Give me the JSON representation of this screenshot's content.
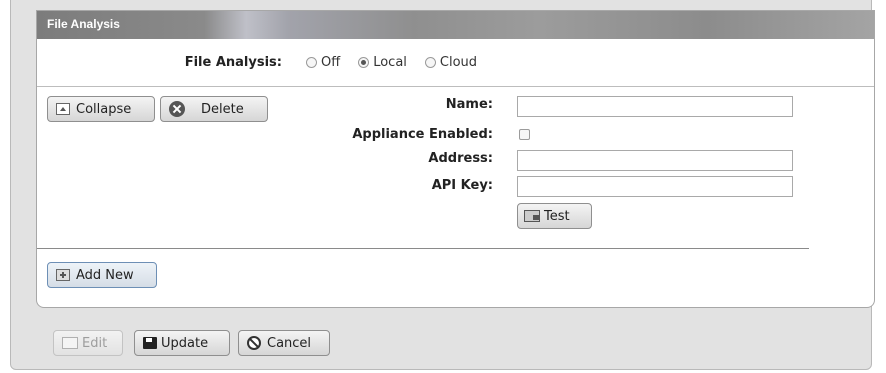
{
  "panel": {
    "title": "File Analysis"
  },
  "file_analysis": {
    "label": "File Analysis:",
    "options": [
      {
        "label": "Off",
        "selected": false
      },
      {
        "label": "Local",
        "selected": true
      },
      {
        "label": "Cloud",
        "selected": false
      }
    ]
  },
  "appliance": {
    "collapse_label": "Collapse",
    "delete_label": "Delete",
    "name_label": "Name:",
    "name_value": "",
    "enabled_label": "Appliance Enabled:",
    "enabled_checked": false,
    "address_label": "Address:",
    "address_value": "",
    "api_key_label": "API Key:",
    "api_key_value": "",
    "test_label": "Test"
  },
  "add_new_label": "Add New",
  "footer": {
    "edit_label": "Edit",
    "update_label": "Update",
    "cancel_label": "Cancel"
  }
}
